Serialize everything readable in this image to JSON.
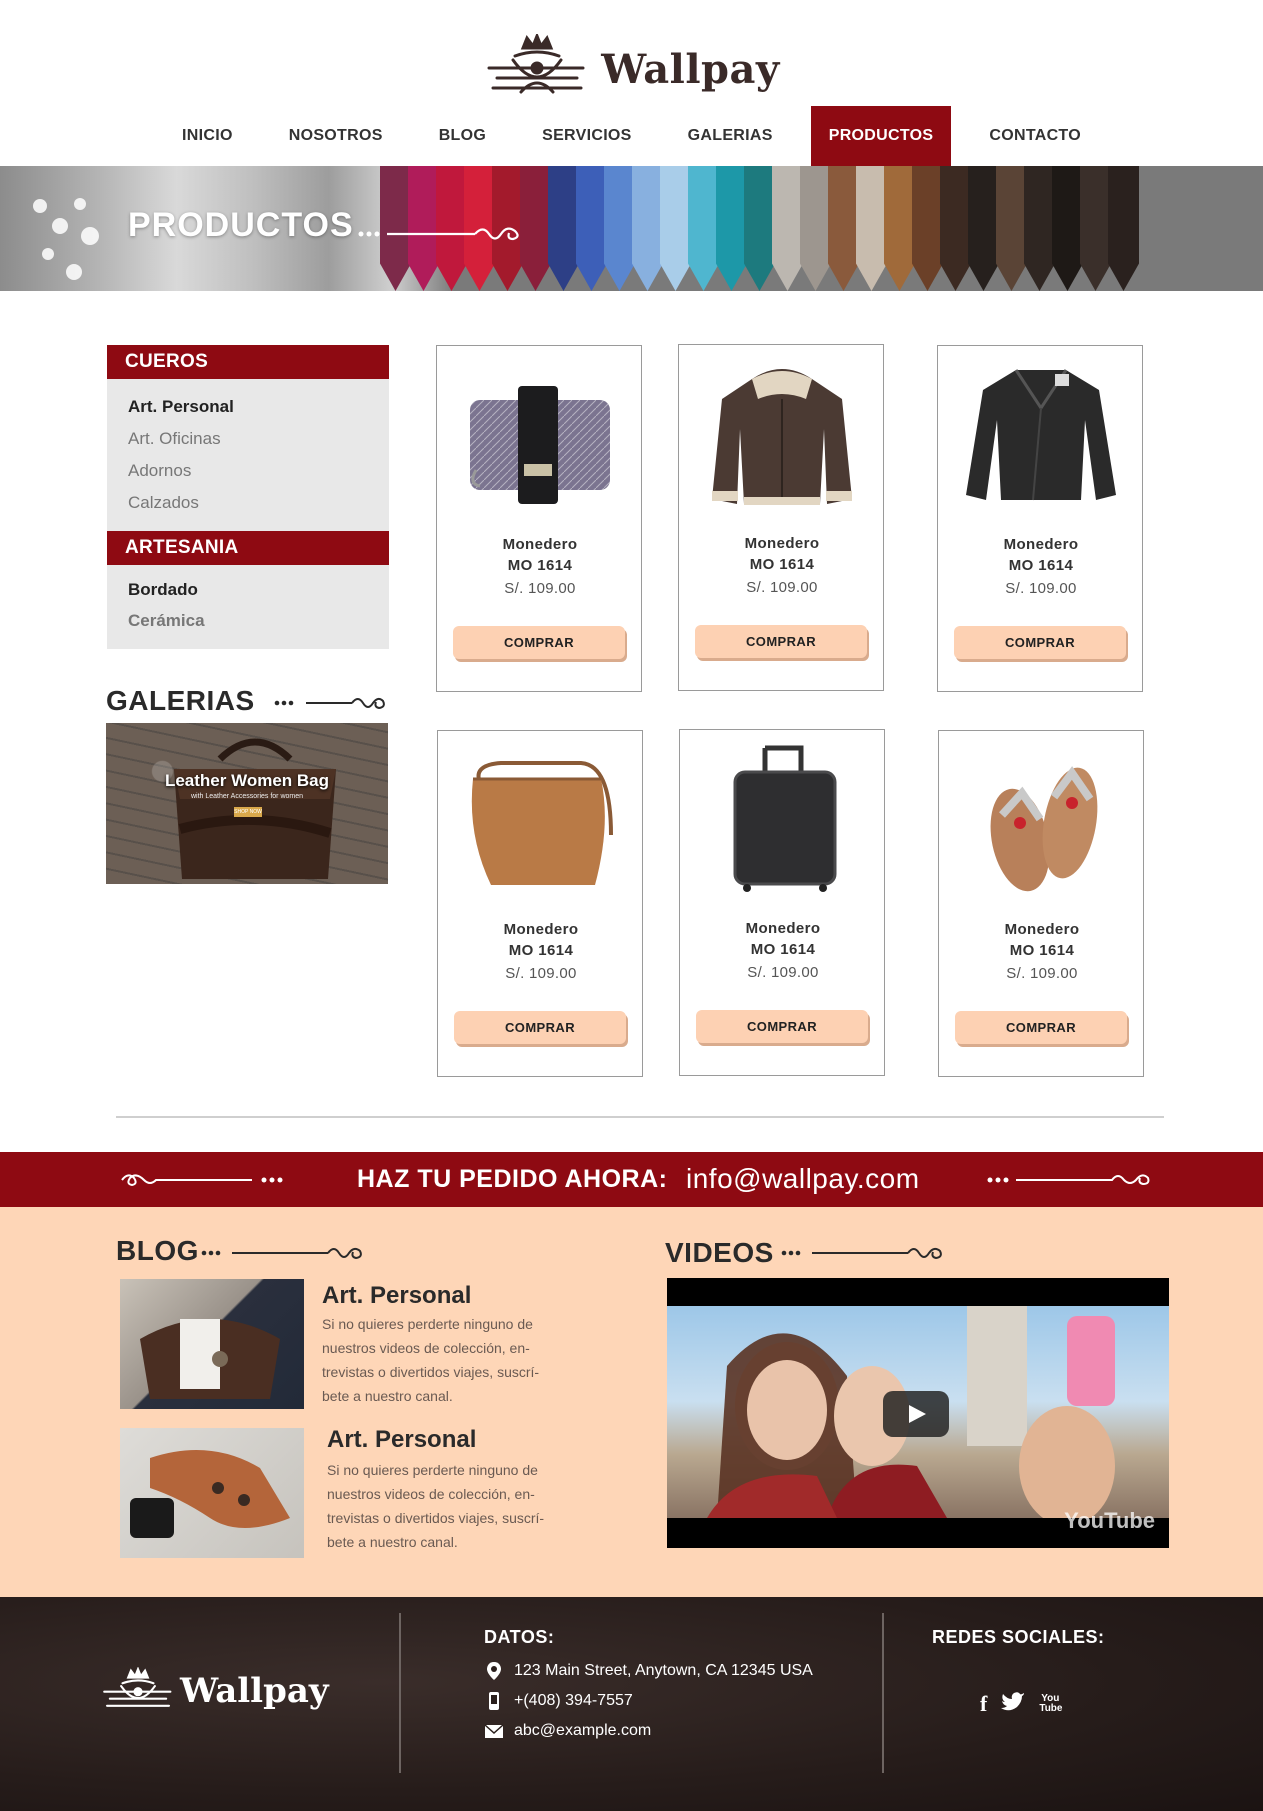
{
  "brand": {
    "name": "Wallpay"
  },
  "nav": {
    "items": [
      {
        "label": "INICIO"
      },
      {
        "label": "NOSOTROS"
      },
      {
        "label": "BLOG"
      },
      {
        "label": "SERVICIOS"
      },
      {
        "label": "GALERIAS"
      },
      {
        "label": "PRODUCTOS",
        "active": true
      },
      {
        "label": "CONTACTO"
      }
    ]
  },
  "banner": {
    "title": "PRODUCTOS"
  },
  "sidebar": {
    "categories": [
      {
        "title": "CUEROS",
        "items": [
          "Art. Personal",
          "Art. Oficinas",
          "Adornos",
          "Calzados"
        ]
      },
      {
        "title": "ARTESANIA",
        "items": [
          "Bordado",
          "Cerámica"
        ]
      }
    ],
    "galleries_title": "GALERIAS",
    "gallery_banner": {
      "title": "Leather Women Bag",
      "subtitle": "with Leather Accessories for women",
      "button": "SHOP NOW"
    }
  },
  "products": [
    {
      "name": "Monedero",
      "code": "MO 1614",
      "price": "S/. 109.00",
      "button": "COMPRAR",
      "icon": "wallet-icon"
    },
    {
      "name": "Monedero",
      "code": "MO 1614",
      "price": "S/. 109.00",
      "button": "COMPRAR",
      "icon": "aviator-jacket-icon"
    },
    {
      "name": "Monedero",
      "code": "MO 1614",
      "price": "S/. 109.00",
      "button": "COMPRAR",
      "icon": "leather-jacket-icon"
    },
    {
      "name": "Monedero",
      "code": "MO 1614",
      "price": "S/. 109.00",
      "button": "COMPRAR",
      "icon": "shoulder-bag-icon"
    },
    {
      "name": "Monedero",
      "code": "MO 1614",
      "price": "S/. 109.00",
      "button": "COMPRAR",
      "icon": "suitcase-icon"
    },
    {
      "name": "Monedero",
      "code": "MO 1614",
      "price": "S/. 109.00",
      "button": "COMPRAR",
      "icon": "sandals-icon"
    }
  ],
  "order": {
    "label": "HAZ TU PEDIDO AHORA:",
    "email": "info@wallpay.com"
  },
  "blog": {
    "title": "BLOG",
    "posts": [
      {
        "title": "Art. Personal",
        "text_lines": [
          "Si no quieres perderte ninguno de",
          "nuestros videos de colección, en-",
          "trevistas o divertidos viajes, suscrí-",
          "bete a nuestro canal."
        ]
      },
      {
        "title": "Art. Personal",
        "text_lines": [
          "Si no quieres perderte ninguno de",
          "nuestros videos de colección, en-",
          "trevistas o divertidos viajes, suscrí-",
          "bete a nuestro canal."
        ]
      }
    ]
  },
  "videos": {
    "title": "VIDEOS",
    "watermark": "YouTube"
  },
  "footer": {
    "brand": "Wallpay",
    "datos_title": "DATOS:",
    "address": "123 Main Street, Anytown, CA 12345 USA",
    "phone": "+(408) 394-7557",
    "email": "abc@example.com",
    "social_title": "REDES SOCIALES:",
    "social": [
      {
        "label": "f",
        "icon": "facebook-icon"
      },
      {
        "label": "t",
        "icon": "twitter-icon"
      },
      {
        "label": "You Tube",
        "icon": "youtube-icon"
      }
    ]
  },
  "colors": {
    "accent": "#8e0a12",
    "peach": "#fed6b7",
    "button": "#fdd1b3",
    "footer": "#261c1a"
  }
}
